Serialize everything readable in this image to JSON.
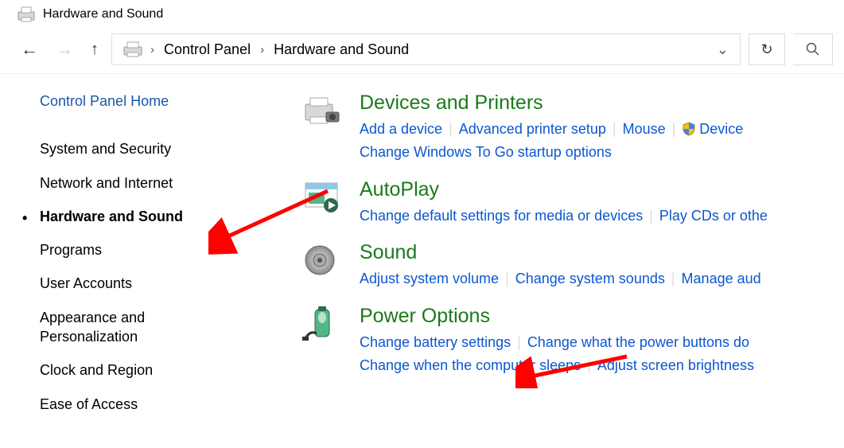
{
  "window": {
    "title": "Hardware and Sound"
  },
  "breadcrumb": {
    "items": [
      "Control Panel",
      "Hardware and Sound"
    ]
  },
  "sidebar": {
    "home": "Control Panel Home",
    "items": [
      "System and Security",
      "Network and Internet",
      "Hardware and Sound",
      "Programs",
      "User Accounts",
      "Appearance and Personalization",
      "Clock and Region",
      "Ease of Access"
    ],
    "active_index": 2
  },
  "categories": [
    {
      "title": "Devices and Printers",
      "links": [
        "Add a device",
        "Advanced printer setup",
        "Mouse",
        "Device",
        "Change Windows To Go startup options"
      ],
      "shield_index": 3
    },
    {
      "title": "AutoPlay",
      "links": [
        "Change default settings for media or devices",
        "Play CDs or othe"
      ]
    },
    {
      "title": "Sound",
      "links": [
        "Adjust system volume",
        "Change system sounds",
        "Manage aud"
      ]
    },
    {
      "title": "Power Options",
      "links": [
        "Change battery settings",
        "Change what the power buttons do",
        "Change when the computer sleeps",
        "Adjust screen brightness"
      ]
    }
  ]
}
